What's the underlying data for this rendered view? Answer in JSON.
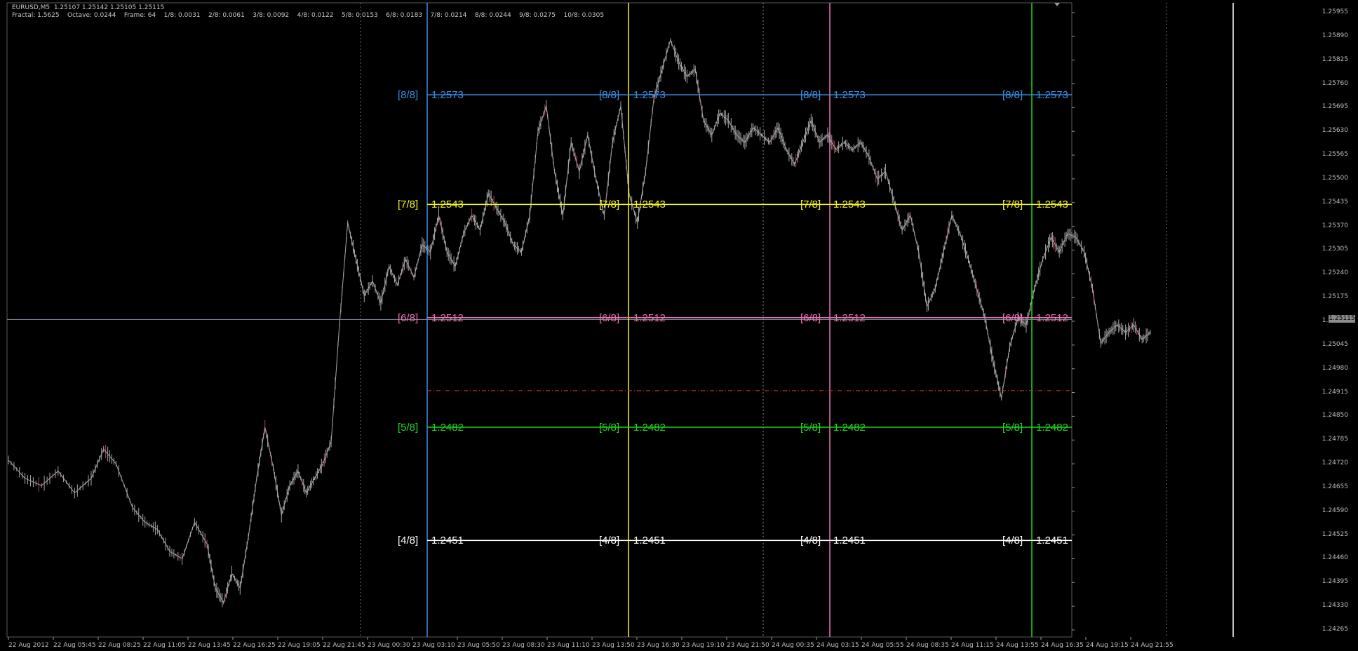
{
  "header": {
    "symbol_line": "EURUSD,M5  1.25107 1.25142 1.25105 1.25115",
    "info_line": "Fractal: 1.5625    Octave: 0.0244    Frame: 64    1/8: 0.0031    2/8: 0.0061    3/8: 0.0092    4/8: 0.0122    5/8: 0.0153    6/8: 0.0183    7/8: 0.0214    8/8: 0.0244    9/8: 0.0275    10/8: 0.0305"
  },
  "colors": {
    "background": "#000000",
    "price_line": "#a6a6a6",
    "down_bar": "#c0404a",
    "blue": "#3d8ee6",
    "yellow": "#f5f51e",
    "pink": "#ee74b4",
    "green": "#1ed81e",
    "white": "#ffffff",
    "red_dash": "#cc3a3a",
    "grid": "#9a9a9a"
  },
  "chart_data": {
    "type": "line",
    "symbol": "EURUSD",
    "timeframe": "M5",
    "ylim": [
      1.2423,
      1.2597
    ],
    "y_ticks": [
      "1.25955",
      "1.25890",
      "1.25825",
      "1.25760",
      "1.25695",
      "1.25630",
      "1.25565",
      "1.25500",
      "1.25435",
      "1.25370",
      "1.25305",
      "1.25240",
      "1.25175",
      "1.25110",
      "1.25045",
      "1.24980",
      "1.24915",
      "1.24850",
      "1.24785",
      "1.24720",
      "1.24655",
      "1.24590",
      "1.24525",
      "1.24460",
      "1.24395",
      "1.24330",
      "1.24265"
    ],
    "x_ticks": [
      "22 Aug 2012",
      "22 Aug 05:45",
      "22 Aug 08:25",
      "22 Aug 11:05",
      "22 Aug 13:45",
      "22 Aug 16:25",
      "22 Aug 19:05",
      "22 Aug 21:45",
      "23 Aug 00:30",
      "23 Aug 03:10",
      "23 Aug 05:50",
      "23 Aug 08:30",
      "23 Aug 11:10",
      "23 Aug 13:50",
      "23 Aug 16:30",
      "23 Aug 19:10",
      "23 Aug 21:50",
      "24 Aug 00:35",
      "24 Aug 03:15",
      "24 Aug 05:55",
      "24 Aug 08:35",
      "24 Aug 11:15",
      "24 Aug 13:55",
      "24 Aug 16:35",
      "24 Aug 19:15",
      "24 Aug 21:55"
    ],
    "current_price": "1.25115",
    "price_path": [
      [
        0,
        1.2473
      ],
      [
        4,
        1.2468
      ],
      [
        8,
        1.2466
      ],
      [
        12,
        1.247
      ],
      [
        16,
        1.2464
      ],
      [
        20,
        1.2468
      ],
      [
        23,
        1.2476
      ],
      [
        26,
        1.2472
      ],
      [
        30,
        1.246
      ],
      [
        33,
        1.2456
      ],
      [
        36,
        1.2454
      ],
      [
        39,
        1.2448
      ],
      [
        42,
        1.2446
      ],
      [
        45,
        1.2456
      ],
      [
        48,
        1.245
      ],
      [
        50,
        1.2438
      ],
      [
        52,
        1.2434
      ],
      [
        54,
        1.2442
      ],
      [
        56,
        1.2438
      ],
      [
        58,
        1.2452
      ],
      [
        60,
        1.2468
      ],
      [
        62,
        1.2482
      ],
      [
        64,
        1.2471
      ],
      [
        66,
        1.2458
      ],
      [
        68,
        1.2466
      ],
      [
        70,
        1.247
      ],
      [
        72,
        1.2464
      ],
      [
        74,
        1.2468
      ],
      [
        76,
        1.2472
      ],
      [
        78,
        1.2478
      ],
      [
        80,
        1.251
      ],
      [
        82,
        1.2538
      ],
      [
        84,
        1.2528
      ],
      [
        86,
        1.2518
      ],
      [
        88,
        1.2522
      ],
      [
        90,
        1.2516
      ],
      [
        92,
        1.2526
      ],
      [
        94,
        1.2521
      ],
      [
        96,
        1.2528
      ],
      [
        98,
        1.2523
      ],
      [
        100,
        1.2532
      ],
      [
        102,
        1.253
      ],
      [
        104,
        1.254
      ],
      [
        106,
        1.253
      ],
      [
        108,
        1.2526
      ],
      [
        110,
        1.2535
      ],
      [
        112,
        1.254
      ],
      [
        114,
        1.2536
      ],
      [
        116,
        1.2546
      ],
      [
        118,
        1.2542
      ],
      [
        120,
        1.2538
      ],
      [
        122,
        1.2532
      ],
      [
        124,
        1.253
      ],
      [
        126,
        1.254
      ],
      [
        128,
        1.2563
      ],
      [
        130,
        1.257
      ],
      [
        132,
        1.2552
      ],
      [
        134,
        1.254
      ],
      [
        136,
        1.256
      ],
      [
        138,
        1.2552
      ],
      [
        140,
        1.2562
      ],
      [
        142,
        1.255
      ],
      [
        144,
        1.254
      ],
      [
        146,
        1.256
      ],
      [
        148,
        1.257
      ],
      [
        150,
        1.2546
      ],
      [
        152,
        1.2538
      ],
      [
        154,
        1.2552
      ],
      [
        156,
        1.2572
      ],
      [
        158,
        1.258
      ],
      [
        160,
        1.2588
      ],
      [
        162,
        1.2582
      ],
      [
        164,
        1.2578
      ],
      [
        166,
        1.258
      ],
      [
        168,
        1.2566
      ],
      [
        170,
        1.2562
      ],
      [
        172,
        1.2568
      ],
      [
        174,
        1.2566
      ],
      [
        176,
        1.2562
      ],
      [
        178,
        1.256
      ],
      [
        180,
        1.2564
      ],
      [
        182,
        1.2562
      ],
      [
        184,
        1.256
      ],
      [
        186,
        1.2564
      ],
      [
        188,
        1.2558
      ],
      [
        190,
        1.2554
      ],
      [
        192,
        1.256
      ],
      [
        194,
        1.2566
      ],
      [
        196,
        1.256
      ],
      [
        198,
        1.2562
      ],
      [
        200,
        1.2558
      ],
      [
        202,
        1.256
      ],
      [
        204,
        1.2558
      ],
      [
        206,
        1.256
      ],
      [
        208,
        1.2556
      ],
      [
        210,
        1.255
      ],
      [
        212,
        1.2552
      ],
      [
        214,
        1.2544
      ],
      [
        216,
        1.2536
      ],
      [
        218,
        1.254
      ],
      [
        220,
        1.253
      ],
      [
        222,
        1.2515
      ],
      [
        224,
        1.252
      ],
      [
        226,
        1.253
      ],
      [
        228,
        1.254
      ],
      [
        230,
        1.2535
      ],
      [
        232,
        1.2528
      ],
      [
        234,
        1.252
      ],
      [
        236,
        1.2512
      ],
      [
        238,
        1.25
      ],
      [
        240,
        1.249
      ],
      [
        242,
        1.2504
      ],
      [
        244,
        1.2512
      ],
      [
        246,
        1.251
      ],
      [
        248,
        1.252
      ],
      [
        250,
        1.2528
      ],
      [
        252,
        1.2534
      ],
      [
        254,
        1.253
      ],
      [
        256,
        1.2535
      ],
      [
        258,
        1.2534
      ],
      [
        260,
        1.253
      ],
      [
        262,
        1.252
      ],
      [
        264,
        1.2505
      ],
      [
        266,
        1.2508
      ],
      [
        268,
        1.251
      ],
      [
        270,
        1.2508
      ],
      [
        272,
        1.251
      ],
      [
        274,
        1.2506
      ],
      [
        276,
        1.2508
      ]
    ]
  },
  "murrey": {
    "levels": [
      {
        "tag": "[8/8]",
        "value": "1.2573",
        "price": 1.2573,
        "color": "#3d8ee6"
      },
      {
        "tag": "[7/8]",
        "value": "1.2543",
        "price": 1.2543,
        "color": "#f5f51e"
      },
      {
        "tag": "[6/8]",
        "value": "1.2512",
        "price": 1.2512,
        "color": "#ee74b4"
      },
      {
        "tag": "[5/8]",
        "value": "1.2482",
        "price": 1.2482,
        "color": "#1ed81e"
      },
      {
        "tag": "[4/8]",
        "value": "1.2451",
        "price": 1.2451,
        "color": "#ffffff"
      }
    ],
    "dash_price": 1.2492,
    "vertical_colors": [
      "#3d8ee6",
      "#f5f51e",
      "#ee74b4",
      "#1ed81e",
      "#ffffff"
    ]
  }
}
